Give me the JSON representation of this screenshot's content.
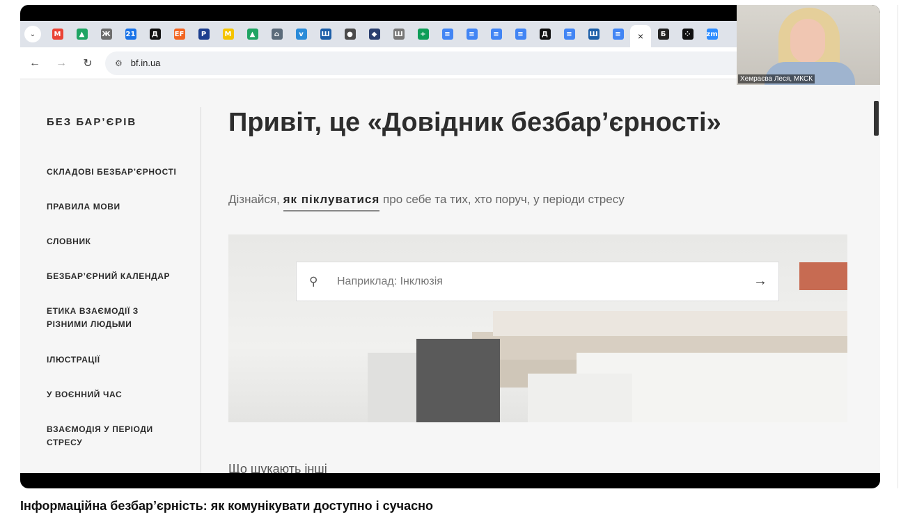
{
  "video": {
    "title": "Інформаційна безбар’єрність: як комунікувати доступно і сучасно"
  },
  "browser": {
    "tabs": [
      {
        "icon": "gmail-icon",
        "glyph": "M",
        "color": "#ea4335"
      },
      {
        "icon": "google-drive-icon",
        "glyph": "▲",
        "color": "#1fa463"
      },
      {
        "icon": "site-icon",
        "glyph": "Ж",
        "color": "#6d6d6d"
      },
      {
        "icon": "calendar-icon",
        "glyph": "21",
        "color": "#1a73e8"
      },
      {
        "icon": "diia-icon",
        "glyph": "Д",
        "color": "#111111"
      },
      {
        "icon": "ef-icon",
        "glyph": "EF",
        "color": "#f26522"
      },
      {
        "icon": "rada-icon",
        "glyph": "Р",
        "color": "#1d3f8f"
      },
      {
        "icon": "m-icon",
        "glyph": "M",
        "color": "#f5c400"
      },
      {
        "icon": "google-drive-icon",
        "glyph": "▲",
        "color": "#1fa463"
      },
      {
        "icon": "building-icon",
        "glyph": "⌂",
        "color": "#5b6b7a"
      },
      {
        "icon": "bird-icon",
        "glyph": "v",
        "color": "#2a8bd8"
      },
      {
        "icon": "trident-icon",
        "glyph": "Ш",
        "color": "#1d5fa8"
      },
      {
        "icon": "globe-icon",
        "glyph": "●",
        "color": "#4a4a4a"
      },
      {
        "icon": "compass-icon",
        "glyph": "◆",
        "color": "#2a3f6f"
      },
      {
        "icon": "emblem-icon",
        "glyph": "Ш",
        "color": "#777777"
      },
      {
        "icon": "sheets-icon",
        "glyph": "+",
        "color": "#0f9d58"
      },
      {
        "icon": "docs-icon",
        "glyph": "≡",
        "color": "#4285f4"
      },
      {
        "icon": "docs-icon",
        "glyph": "≡",
        "color": "#4285f4"
      },
      {
        "icon": "docs-icon",
        "glyph": "≡",
        "color": "#4285f4"
      },
      {
        "icon": "docs-icon",
        "glyph": "≡",
        "color": "#4285f4"
      },
      {
        "icon": "diia-icon",
        "glyph": "Д",
        "color": "#111111"
      },
      {
        "icon": "docs-icon",
        "glyph": "≡",
        "color": "#4285f4"
      },
      {
        "icon": "trident-icon",
        "glyph": "Ш",
        "color": "#1d5fa8"
      },
      {
        "icon": "docs-icon",
        "glyph": "≡",
        "color": "#4285f4"
      }
    ],
    "active_tab_close": "×",
    "extra_tabs": [
      {
        "icon": "b-letter-icon",
        "glyph": "Б",
        "color": "#222222"
      },
      {
        "icon": "dots-icon",
        "glyph": "⁘",
        "color": "#111111"
      },
      {
        "icon": "zoom-icon",
        "glyph": "zm",
        "color": "#2d8cff"
      }
    ],
    "url": "bf.in.ua"
  },
  "page": {
    "brand": "БЕЗ БАР’ЄРІВ",
    "nav": [
      "СКЛАДОВІ БЕЗБАР’ЄРНОСТІ",
      "ПРАВИЛА МОВИ",
      "СЛОВНИК",
      "БЕЗБАР’ЄРНИЙ КАЛЕНДАР",
      "ЕТИКА ВЗАЄМОДІЇ З РІЗНИМИ ЛЮДЬМИ",
      "ІЛЮСТРАЦІЇ",
      "У ВОЄННИЙ ЧАС",
      "ВЗАЄМОДІЯ У ПЕРІОДИ СТРЕСУ"
    ],
    "heading": "Привіт, це «Довідник безбар’єрності»",
    "intro_before": "Дізнайся, ",
    "intro_bold": "як піклуватися",
    "intro_after": " про себе та тих, хто поруч, у періоди стресу",
    "search_placeholder": "Наприклад: Інклюзія",
    "more_heading": "Що шукають інші"
  },
  "zoom": {
    "logo": "zoom",
    "participant_name": "Хемраєва Леся, МКСК"
  },
  "colors": {
    "accent_red": "#e1392b",
    "tabstrip": "#dfe3ea"
  }
}
